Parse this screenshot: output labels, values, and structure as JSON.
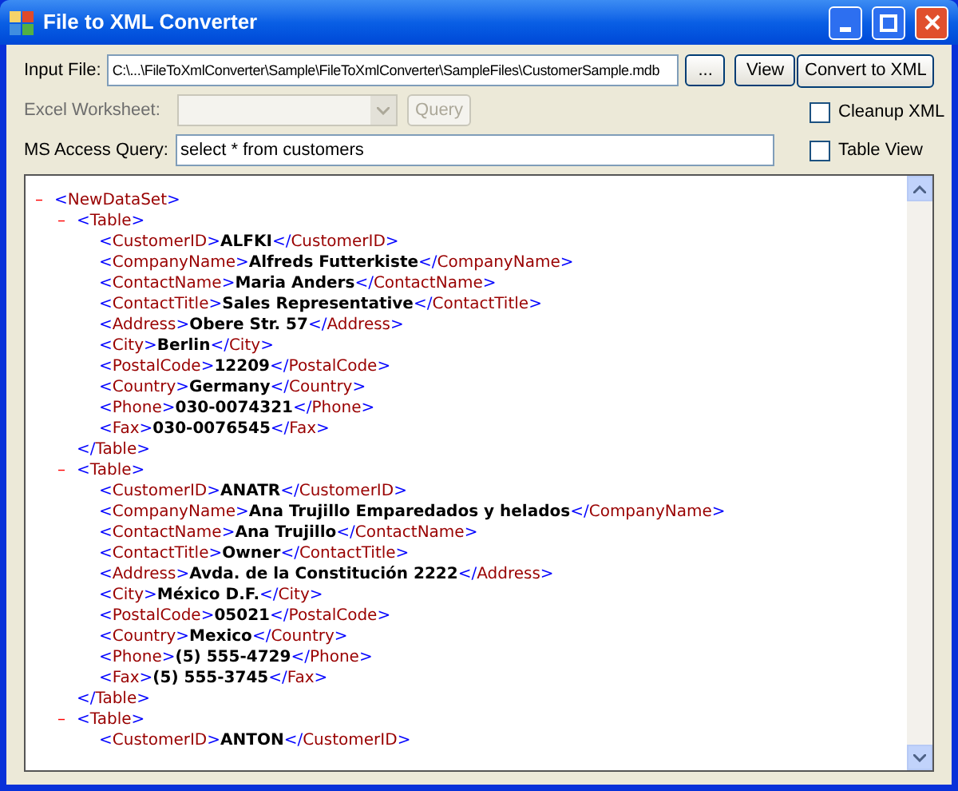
{
  "window": {
    "title": "File to XML Converter"
  },
  "input_file": {
    "label": "Input File:",
    "value": "C:\\...\\FileToXmlConverter\\Sample\\FileToXmlConverter\\SampleFiles\\CustomerSample.mdb"
  },
  "browse_button": {
    "label": "..."
  },
  "view_button": {
    "label": "View"
  },
  "convert_button": {
    "label": "Convert to XML"
  },
  "excel_worksheet": {
    "label": "Excel Worksheet:",
    "disabled": true
  },
  "query_button": {
    "label": "Query",
    "disabled": true
  },
  "access_query": {
    "label": "MS Access Query:",
    "value": "select * from customers"
  },
  "options": [
    {
      "label": "Cleanup XML",
      "checked": false
    },
    {
      "label": "Table View",
      "checked": false
    }
  ],
  "xml_view": {
    "nodes": [
      {
        "toggle": "–",
        "open": "<NewDataSet>",
        "children": [
          {
            "toggle": "–",
            "open": "<Table>",
            "close": "</Table>",
            "children": [
              {
                "open": "<CustomerID>",
                "value": "ALFKI",
                "close": "</CustomerID>"
              },
              {
                "open": "<CompanyName>",
                "value": "Alfreds Futterkiste",
                "close": "</CompanyName>"
              },
              {
                "open": "<ContactName>",
                "value": "Maria Anders",
                "close": "</ContactName>"
              },
              {
                "open": "<ContactTitle>",
                "value": "Sales Representative",
                "close": "</ContactTitle>"
              },
              {
                "open": "<Address>",
                "value": "Obere Str. 57",
                "close": "</Address>"
              },
              {
                "open": "<City>",
                "value": "Berlin",
                "close": "</City>"
              },
              {
                "open": "<PostalCode>",
                "value": "12209",
                "close": "</PostalCode>"
              },
              {
                "open": "<Country>",
                "value": "Germany",
                "close": "</Country>"
              },
              {
                "open": "<Phone>",
                "value": "030-0074321",
                "close": "</Phone>"
              },
              {
                "open": "<Fax>",
                "value": "030-0076545",
                "close": "</Fax>"
              }
            ]
          },
          {
            "toggle": "–",
            "open": "<Table>",
            "close": "</Table>",
            "children": [
              {
                "open": "<CustomerID>",
                "value": "ANATR",
                "close": "</CustomerID>"
              },
              {
                "open": "<CompanyName>",
                "value": "Ana Trujillo Emparedados y helados",
                "close": "</CompanyName>"
              },
              {
                "open": "<ContactName>",
                "value": "Ana Trujillo",
                "close": "</ContactName>"
              },
              {
                "open": "<ContactTitle>",
                "value": "Owner",
                "close": "</ContactTitle>"
              },
              {
                "open": "<Address>",
                "value": "Avda. de la Constitución 2222",
                "close": "</Address>"
              },
              {
                "open": "<City>",
                "value": "México D.F.",
                "close": "</City>"
              },
              {
                "open": "<PostalCode>",
                "value": "05021",
                "close": "</PostalCode>"
              },
              {
                "open": "<Country>",
                "value": "Mexico",
                "close": "</Country>"
              },
              {
                "open": "<Phone>",
                "value": "(5) 555-4729",
                "close": "</Phone>"
              },
              {
                "open": "<Fax>",
                "value": "(5) 555-3745",
                "close": "</Fax>"
              }
            ]
          },
          {
            "toggle": "–",
            "open": "<Table>",
            "children": [
              {
                "open": "<CustomerID>",
                "value": "ANTON",
                "close": "</CustomerID>"
              }
            ]
          }
        ]
      }
    ]
  }
}
